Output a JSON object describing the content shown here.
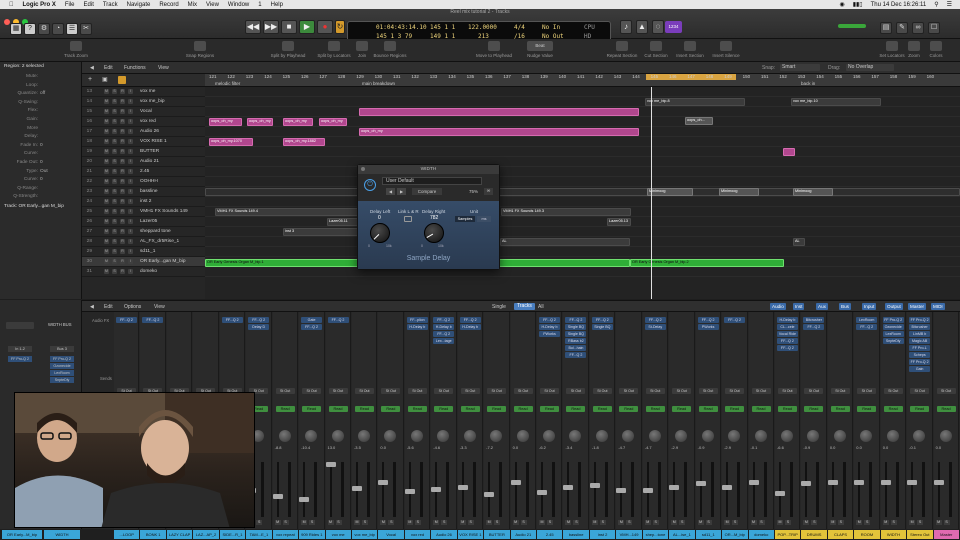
{
  "menubar": {
    "items": [
      "Logic Pro X",
      "File",
      "Edit",
      "Track",
      "Navigate",
      "Record",
      "Mix",
      "View",
      "Window",
      "1",
      "Help"
    ],
    "clock": "Thu 14 Dec 16:26:11",
    "window_title": "Reel mix tutorial 2 - Tracks"
  },
  "lcd": {
    "smpte": "01:04:43:14.10",
    "smpte2": "145  1  3  79",
    "bars1": "145  1  1",
    "bars2": "149  1  1",
    "tempo": "122.0000",
    "tempo2": "213",
    "sig": "4/4",
    "sig2": "/16",
    "in": "No In",
    "out": "No Out",
    "cpu": "CPU",
    "hd": "HD"
  },
  "controlbar": {
    "badge": "1234"
  },
  "toolbar": {
    "items": [
      "Track Zoom",
      "Snap Regions",
      "Split by Playhead",
      "Split by Locators",
      "Join",
      "Bounce Regions",
      "Move to Playhead",
      "Nudge Value",
      "Repeat Section",
      "Cut Section",
      "Insert Section",
      "Insert Silence",
      "Set Locators",
      "Zoom",
      "Colors"
    ],
    "nudge_value": "Beat"
  },
  "inspector": {
    "region_title": "Region: 2 selected",
    "fields": [
      {
        "k": "Mute:",
        "v": ""
      },
      {
        "k": "Loop:",
        "v": ""
      },
      {
        "k": "Quantize:",
        "v": "off"
      },
      {
        "k": "Q-Swing:",
        "v": ""
      },
      {
        "k": "Flex:",
        "v": ""
      },
      {
        "k": "Gain:",
        "v": ""
      },
      {
        "k": "More",
        "v": ""
      },
      {
        "k": "Delay:",
        "v": ""
      },
      {
        "k": "Fade In:",
        "v": "0"
      },
      {
        "k": "Curve:",
        "v": ""
      },
      {
        "k": "Fade Out:",
        "v": "0"
      },
      {
        "k": "Type:",
        "v": "Out"
      },
      {
        "k": "Curve:",
        "v": "0"
      },
      {
        "k": "Q-Range:",
        "v": ""
      },
      {
        "k": "Q-Strength:",
        "v": ""
      }
    ],
    "track_title": "Track:  OR Early...gan M_bip"
  },
  "tracks_header": {
    "edit": "Edit",
    "functions": "Functions",
    "view": "View",
    "snap_label": "Snap:",
    "snap_value": "Smart",
    "drag_label": "Drag:",
    "drag_value": "No Overlap"
  },
  "ruler": {
    "ticks": [
      "121",
      "122",
      "123",
      "124",
      "125",
      "126",
      "127",
      "128",
      "129",
      "130",
      "131",
      "132",
      "133",
      "134",
      "135",
      "136",
      "137",
      "138",
      "139",
      "140",
      "141",
      "142",
      "143",
      "144",
      "145",
      "146",
      "147",
      "148",
      "149",
      "150",
      "151",
      "152",
      "153",
      "154",
      "155",
      "156",
      "157",
      "158",
      "159",
      "160"
    ],
    "markers": [
      "melodic filter",
      "main breakdown",
      "back in"
    ]
  },
  "tracks": [
    {
      "num": "13",
      "name": "vox me"
    },
    {
      "num": "14",
      "name": "vox me_bip"
    },
    {
      "num": "15",
      "name": "Vocal"
    },
    {
      "num": "16",
      "name": "vox red"
    },
    {
      "num": "17",
      "name": "Audio 26"
    },
    {
      "num": "18",
      "name": "VOX RISE 1"
    },
    {
      "num": "19",
      "name": "BUTTER"
    },
    {
      "num": "20",
      "name": "Audio 21"
    },
    {
      "num": "21",
      "name": "2.45"
    },
    {
      "num": "22",
      "name": "OOHHH"
    },
    {
      "num": "23",
      "name": "bassline"
    },
    {
      "num": "24",
      "name": "inst 2"
    },
    {
      "num": "25",
      "name": "VMH1 FX Sounds 149"
    },
    {
      "num": "26",
      "name": "Lazer05"
    },
    {
      "num": "27",
      "name": "sheppard tone"
    },
    {
      "num": "28",
      "name": "AL_FX_dr5Rise_1"
    },
    {
      "num": "29",
      "name": "sd11_1"
    },
    {
      "num": "30",
      "name": "OR Early...gan M_bip"
    },
    {
      "num": "31",
      "name": "domeko"
    }
  ],
  "regions": {
    "vox_me_bip_a": "vox me_bip.8",
    "vox_me_bip_b": "vox me_bip.10",
    "vox_red": "oops_oh_my",
    "audio26": "oops_oh_my",
    "vox_rise": "oops_oh_my.1070",
    "vox_rise2": "oops_oh_my.1882",
    "bassline": "Minimoog",
    "vmh1a": "VMH1 FX Sounds 149.4",
    "vmh1b": "VMH1 FX Sounds 149.3",
    "lazer": "Lazer05.11",
    "lazer2": "Lazer05.13",
    "sheppard": "inst 3",
    "al": "AL",
    "organ_a": "OR Early Genesis Organ M_bip.1",
    "organ_b": "OR Early Genesis Organ M_bip.2",
    "oops_small": "oops_oh..."
  },
  "plugin": {
    "window_title": "WIDTH",
    "preset": "User Default",
    "compare": "Compare",
    "zoom": "75%",
    "delay_left_label": "Delay Left",
    "delay_left_value": "0",
    "link_label": "Link L & R",
    "delay_right_label": "Delay Right",
    "delay_right_value": "782",
    "unit_label": "Unit",
    "unit_samples": "Samples",
    "unit_ms": "ms",
    "knob_min": "0",
    "knob_max": "10k",
    "plugin_name": "Sample Delay"
  },
  "mixer_header": {
    "edit": "Edit",
    "options": "Options",
    "view": "View",
    "single": "Single",
    "tracks": "Tracks",
    "all": "All",
    "filters": [
      "Audio",
      "Inst",
      "Aux",
      "Bus",
      "Input",
      "Output",
      "Master",
      "MIDI"
    ]
  },
  "mixer_left": {
    "width_bus": "WIDTH BUS",
    "in": "In 1-2",
    "bus3": "Bus 3",
    "plugins": [
      "FF Pro-Q 2",
      "FF Pro-Q 2",
      "Ozonecide",
      "LexRoom",
      "SnpteDly"
    ]
  },
  "mixer": {
    "audio_fx_label": "Audio FX",
    "sends_label": "Sends",
    "output_label": "Output",
    "strips": [
      {
        "name": "...LOOP",
        "vol": "-3.5",
        "color": "#3aa6d8",
        "plugins": [
          "FF...Q 2"
        ]
      },
      {
        "name": "BONK 1",
        "vol": "0.0",
        "color": "#3aa6d8",
        "plugins": [
          "FF...Q 2"
        ]
      },
      {
        "name": "LAZY CLAP",
        "vol": "-3.5",
        "color": "#3aa6d8",
        "plugins": []
      },
      {
        "name": "LAZ...AP_2",
        "vol": "-7.8",
        "color": "#3aa6d8",
        "plugins": []
      },
      {
        "name": "SIDE...R_1",
        "vol": "-6.8",
        "color": "#3aa6d8",
        "plugins": [
          "FF...Q 2"
        ]
      },
      {
        "name": "TAM...E_1",
        "vol": "-4.7",
        "color": "#3aa6d8",
        "plugins": [
          "FF...Q 2",
          "Delay D"
        ]
      },
      {
        "name": "vox repeat",
        "vol": "-8.8",
        "color": "#3aa6d8",
        "plugins": []
      },
      {
        "name": "909 Rides 1",
        "vol": "-10.4",
        "color": "#3aa6d8",
        "plugins": [
          "Gate",
          "FF...Q 2"
        ]
      },
      {
        "name": "vox me",
        "vol": "13.0",
        "color": "#3aa6d8",
        "plugins": [
          "FF...Q 2"
        ]
      },
      {
        "name": "vox me_bip",
        "vol": "-3.5",
        "color": "#3aa6d8",
        "plugins": []
      },
      {
        "name": "Vocal",
        "vol": "0.0",
        "color": "#3aa6d8",
        "plugins": []
      },
      {
        "name": "vox red",
        "vol": "-5.6",
        "color": "#3aa6d8",
        "plugins": [
          "FF...plion",
          "H-Delay b"
        ]
      },
      {
        "name": "Audio 26",
        "vol": "-4.6",
        "color": "#3aa6d8",
        "plugins": [
          "FF...Q 2",
          "H-Delay b",
          "FF...Q 2",
          "Lex...tage"
        ]
      },
      {
        "name": "VOX RISE 1",
        "vol": "-3.3",
        "color": "#3aa6d8",
        "plugins": [
          "FF...Q 2",
          "H-Delay b"
        ]
      },
      {
        "name": "BUTTER",
        "vol": "-7.2",
        "color": "#3aa6d8",
        "plugins": []
      },
      {
        "name": "Audio 21",
        "vol": "0.0",
        "color": "#3aa6d8",
        "plugins": []
      },
      {
        "name": "2.45",
        "vol": "-6.2",
        "color": "#3aa6d8",
        "plugins": [
          "FF...Q 2",
          "H-Delay b",
          "PWorks"
        ]
      },
      {
        "name": "bassline",
        "vol": "-3.4",
        "color": "#3aa6d8",
        "plugins": [
          "FF...Q 2",
          "Single BQ",
          "Single BQ",
          "RBass b2",
          "Bul...hain",
          "FF...Q 2"
        ]
      },
      {
        "name": "inst 2",
        "vol": "-1.8",
        "color": "#3aa6d8",
        "plugins": [
          "FF...Q 2",
          "Single BQ"
        ]
      },
      {
        "name": "VMH...149",
        "vol": "-4.7",
        "color": "#3aa6d8",
        "plugins": []
      },
      {
        "name": "shep...tone",
        "vol": "-4.7",
        "color": "#3aa6d8",
        "plugins": [
          "FF...Q 2",
          "St-Delay"
        ]
      },
      {
        "name": "AL...ise_1",
        "vol": "-2.9",
        "color": "#3aa6d8",
        "plugins": []
      },
      {
        "name": "sd11_1",
        "vol": "-0.9",
        "color": "#3aa6d8",
        "plugins": [
          "FF...Q 2",
          "PWorks"
        ]
      },
      {
        "name": "OR...M_bip",
        "vol": "-2.9",
        "color": "#3aa6d8",
        "plugins": [
          "FF...Q 2"
        ]
      },
      {
        "name": "domeko",
        "vol": "-0.1",
        "color": "#3aa6d8",
        "plugins": []
      },
      {
        "name": "POP...TRIP",
        "vol": "-6.6",
        "color": "#e3c43a",
        "plugins": [
          "H-Delay b",
          "CL...cele",
          "Vocal Ride",
          "FF...Q 2",
          "FF...Q 2"
        ]
      },
      {
        "name": "DRUMS",
        "vol": "-0.9",
        "color": "#e3c43a",
        "plugins": [
          "Bitcrusher",
          "FF...Q 2"
        ]
      },
      {
        "name": "CLAPS",
        "vol": "0.0",
        "color": "#e3c43a",
        "plugins": []
      },
      {
        "name": "ROOM",
        "vol": "0.0",
        "color": "#e3c43a",
        "plugins": [
          "LexRoom",
          "FF...Q 2"
        ]
      },
      {
        "name": "WIDTH",
        "vol": "0.0",
        "color": "#e3c43a",
        "plugins": [
          "FF Pro-Q 2",
          "Ozonecide",
          "LexRoom",
          "SnpteDly"
        ]
      },
      {
        "name": "Stereo Out",
        "vol": "-0.1",
        "color": "#e3c43a",
        "plugins": [
          "FF Pro-Q 2",
          "Bitcrusher",
          "LinMB b",
          "Magic AB",
          "FF Pro-L",
          "Scheps",
          "FF Pro-Q 2",
          "Gain"
        ]
      },
      {
        "name": "Master",
        "vol": "0.0",
        "color": "#e06ab0",
        "plugins": []
      }
    ],
    "read_label": "Read",
    "stout_label": "St Out",
    "bus1": "Bus 1",
    "bus3": "Bus 3"
  },
  "namebar_left": [
    "OR Early...M_bip",
    "WIDTH"
  ]
}
